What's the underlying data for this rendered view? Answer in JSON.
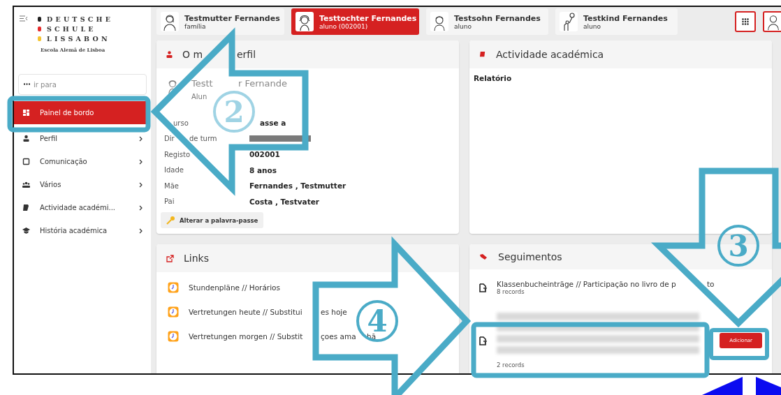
{
  "sidebar": {
    "logo": {
      "lines": [
        {
          "text": "DEUTSCHE",
          "color": "#222222"
        },
        {
          "text": "SCHULE",
          "color": "#e52b2b"
        },
        {
          "text": "LISSABON",
          "color": "#f5c431"
        }
      ],
      "subtitle": "Escola Alemã de Lisboa"
    },
    "search": {
      "placeholder": "ir para"
    },
    "items": [
      {
        "label": "Painel de bordo",
        "selected": true,
        "has_children": false
      },
      {
        "label": "Perfil",
        "selected": false,
        "has_children": true
      },
      {
        "label": "Comunicação",
        "selected": false,
        "has_children": true
      },
      {
        "label": "Vários",
        "selected": false,
        "has_children": true
      },
      {
        "label": "Actividade académi...",
        "selected": false,
        "has_children": true
      },
      {
        "label": "História académica",
        "selected": false,
        "has_children": true
      }
    ]
  },
  "people": [
    {
      "name": "Testmutter Fernandes",
      "role": "família",
      "selected": false
    },
    {
      "name": "Testtochter Fernandes",
      "role": "aluno (002001)",
      "selected": true
    },
    {
      "name": "Testsohn Fernandes",
      "role": "aluno",
      "selected": false
    },
    {
      "name": "Testkind Fernandes",
      "role": "aluno",
      "selected": false
    }
  ],
  "profile": {
    "title_parts": [
      "O m",
      "erfil"
    ],
    "name_parts": [
      "Testt",
      "r Fernande"
    ],
    "role": "Alun",
    "rows": [
      {
        "label_parts": [
          "urso"
        ],
        "value": "asse a",
        "redacted": false
      },
      {
        "label_parts": [
          "Dir",
          "de turm"
        ],
        "redacted": true
      },
      {
        "label_parts": [
          "Registo"
        ],
        "value": "002001",
        "redacted": false
      },
      {
        "label_parts": [
          "Idade"
        ],
        "value": "8 anos",
        "redacted": false
      },
      {
        "label_parts": [
          "Mãe"
        ],
        "value": "Fernandes , Testmutter",
        "redacted": false
      },
      {
        "label_parts": [
          "Pai"
        ],
        "value": "Costa , Testvater",
        "redacted": false
      }
    ],
    "button": "Alterar a palavra-passe"
  },
  "activity": {
    "title": "Actividade académica",
    "section": "Relatório"
  },
  "links": {
    "title": "Links",
    "items": [
      {
        "parts": [
          "Stundenpläne // Horários"
        ]
      },
      {
        "parts": [
          "Vertretungen heute // Substitui",
          "es hoje"
        ]
      },
      {
        "parts": [
          "Vertretungen morgen // Substit",
          "çoes ama",
          "hã"
        ]
      }
    ]
  },
  "follow_ups": {
    "title": "Seguimentos",
    "items": [
      {
        "title_parts": [
          "Klassenbucheinträge // Participação no livro de p",
          "to"
        ],
        "count": "8 records",
        "blurred": false
      },
      {
        "count": "2 records",
        "blurred": true,
        "action": "Adicionar"
      }
    ]
  },
  "annotations": [
    {
      "number": "2"
    },
    {
      "number": "3"
    },
    {
      "number": "4"
    }
  ]
}
